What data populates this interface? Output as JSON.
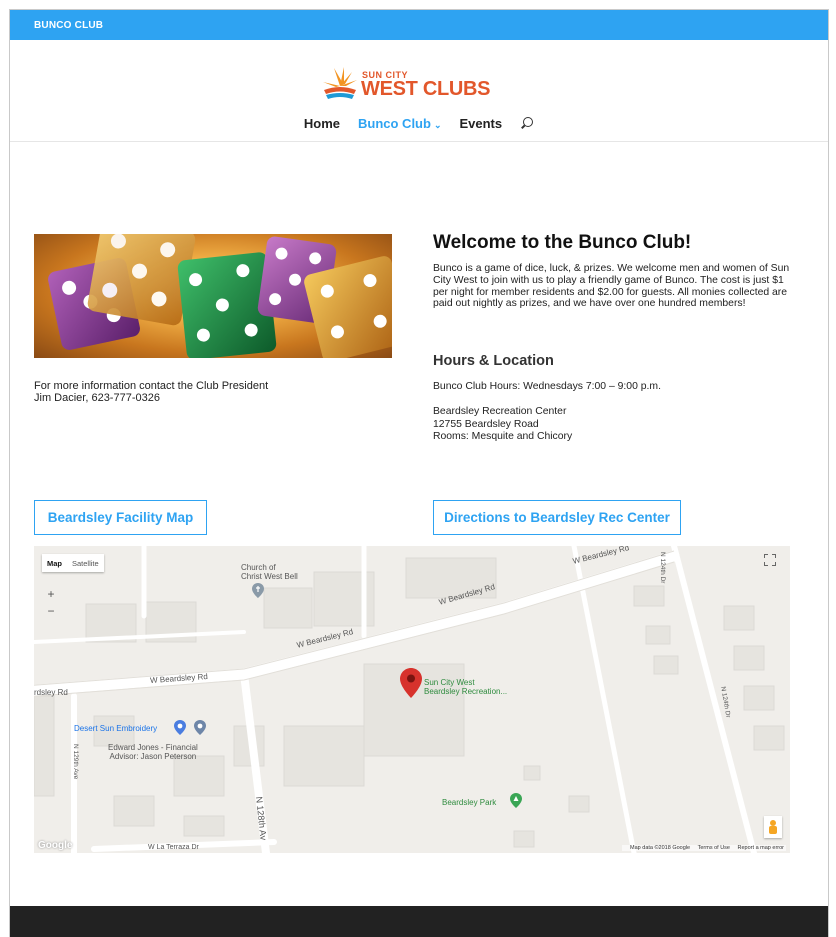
{
  "topbar": {
    "title": "BUNCO CLUB"
  },
  "logo": {
    "line1": "SUN CITY",
    "line2": "WEST CLUBS"
  },
  "nav": {
    "items": [
      {
        "label": "Home",
        "active": false
      },
      {
        "label": "Bunco Club",
        "active": true,
        "chevron": "⌄"
      },
      {
        "label": "Events",
        "active": false
      }
    ]
  },
  "contact": {
    "line1": "For more information contact the Club President",
    "line2": "Jim Dacier, 623-777-0326"
  },
  "welcome": {
    "title": "Welcome to the Bunco Club!",
    "text": "Bunco is a game of dice, luck, & prizes.  We welcome men and women of Sun City West to join with us to play a friendly game of Bunco. The cost is just $1 per night for member residents and $2.00 for guests. All monies collected are paid out nightly as prizes, and we have over one hundred members!"
  },
  "hours": {
    "title": "Hours & Location",
    "text": "Bunco Club Hours:  Wednesdays  7:00 – 9:00 p.m.",
    "location_name": "Beardsley Recreation Center",
    "location_address": "12755 Beardsley Road",
    "location_rooms": "Rooms: Mesquite and Chicory"
  },
  "buttons": {
    "facility_map": "Beardsley Facility Map",
    "directions": "Directions to Beardsley Rec Center"
  },
  "map": {
    "type_map": "Map",
    "type_satellite": "Satellite",
    "zoom_in": "+",
    "zoom_out": "−",
    "labels": {
      "church_1": "Church of",
      "church_2": "Christ West Bell",
      "beardsley_rd_1": "W Beardsley Rd",
      "beardsley_rd_2": "W Beardsley Rd",
      "beardsley_rd_3": "W Beardsley Rd",
      "beardsley_rd_4": "W Beardsley Rd",
      "beardsley_rd_left": "rdsley Rd",
      "embroidery": "Desert Sun Embroidery",
      "edward_jones_1": "Edward Jones - Financial",
      "edward_jones_2": "Advisor: Jason Peterson",
      "n129th": "N 129th Ave",
      "n128th": "N 128th Av",
      "n124th_top": "N 124th Dr",
      "n124th_right": "N 124th Dr",
      "la_terraza": "W La Terraza Dr",
      "scw_1": "Sun City West",
      "scw_2": "Beardsley Recreation...",
      "park": "Beardsley Park"
    },
    "google": "Google",
    "attribution": "Map data ©2018 Google",
    "terms": "Terms of Use",
    "report": "Report a map error",
    "icons": [
      "fullscreen-icon",
      "pegman-icon",
      "location-pin-icon"
    ]
  }
}
